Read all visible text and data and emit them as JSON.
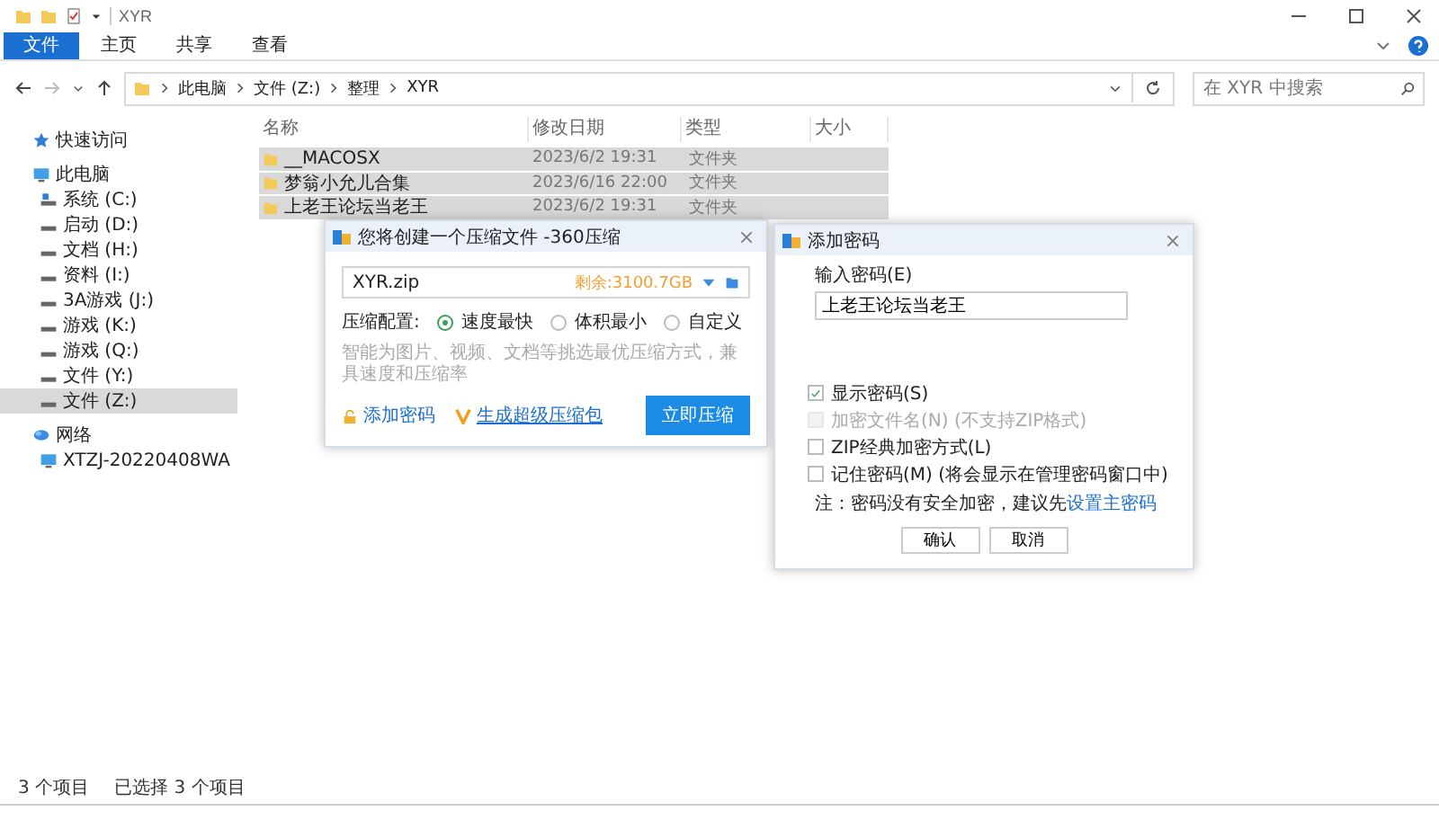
{
  "window": {
    "title": "XYR"
  },
  "ribbon_tabs": [
    {
      "label": "文件",
      "selected": true
    },
    {
      "label": "主页",
      "selected": false
    },
    {
      "label": "共享",
      "selected": false
    },
    {
      "label": "查看",
      "selected": false
    }
  ],
  "address": {
    "breadcrumbs": [
      "此电脑",
      "文件 (Z:)",
      "整理",
      "XYR"
    ],
    "search_placeholder": "在 XYR 中搜索"
  },
  "sidebar": {
    "items": [
      {
        "label": "快速访问",
        "kind": "star",
        "selected": false
      },
      {
        "label": "此电脑",
        "kind": "pc",
        "selected": false,
        "children": [
          {
            "label": "系统 (C:)",
            "kind": "system",
            "selected": false
          },
          {
            "label": "启动 (D:)",
            "kind": "drive",
            "selected": false
          },
          {
            "label": "文档 (H:)",
            "kind": "drive",
            "selected": false
          },
          {
            "label": "资料 (I:)",
            "kind": "drive",
            "selected": false
          },
          {
            "label": "3A游戏 (J:)",
            "kind": "drive",
            "selected": false
          },
          {
            "label": "游戏 (K:)",
            "kind": "drive",
            "selected": false
          },
          {
            "label": "游戏 (Q:)",
            "kind": "drive",
            "selected": false
          },
          {
            "label": "文件 (Y:)",
            "kind": "drive",
            "selected": false
          },
          {
            "label": "文件 (Z:)",
            "kind": "drive",
            "selected": true
          }
        ]
      },
      {
        "label": "网络",
        "kind": "network",
        "selected": false,
        "children": [
          {
            "label": "XTZJ-20220408WA",
            "kind": "pc",
            "selected": false
          }
        ]
      }
    ]
  },
  "table": {
    "columns": [
      "名称",
      "修改日期",
      "类型",
      "大小"
    ],
    "rows": [
      {
        "name": "__MACOSX",
        "date": "2023/6/2 19:31",
        "type": "文件夹",
        "selected": true
      },
      {
        "name": "梦翁小允儿合集",
        "date": "2023/6/16 22:00",
        "type": "文件夹",
        "selected": true
      },
      {
        "name": "上老王论坛当老王",
        "date": "2023/6/2 19:31",
        "type": "文件夹",
        "selected": true
      }
    ]
  },
  "status_bar": [
    "3 个项目",
    "已选择 3 个项目"
  ],
  "compress_dialog": {
    "title": "您将创建一个压缩文件 -360压缩",
    "filename": "XYR.zip",
    "free_space": "剩余:3100.7GB",
    "config_label": "压缩配置:",
    "options": [
      {
        "label": "速度最快",
        "selected": true
      },
      {
        "label": "体积最小",
        "selected": false
      },
      {
        "label": "自定义",
        "selected": false
      }
    ],
    "hint": "智能为图片、视频、文档等挑选最优压缩方式，兼具速度和压缩率",
    "add_password": "添加密码",
    "super_pack": "生成超级压缩包",
    "button": "立即压缩"
  },
  "password_dialog": {
    "title": "添加密码",
    "field_label": "输入密码(E)",
    "value": "上老王论坛当老王",
    "checkboxes": [
      {
        "label": "显示密码(S)",
        "checked": true,
        "disabled": false
      },
      {
        "label": "加密文件名(N) (不支持ZIP格式)",
        "checked": false,
        "disabled": true
      },
      {
        "label": "ZIP经典加密方式(L)",
        "checked": false,
        "disabled": false
      },
      {
        "label": "记住密码(M) (将会显示在管理密码窗口中)",
        "checked": false,
        "disabled": false
      }
    ],
    "note": "注：密码没有安全加密，建议先",
    "note_link": "设置主密码",
    "buttons": [
      "确认",
      "取消"
    ]
  }
}
